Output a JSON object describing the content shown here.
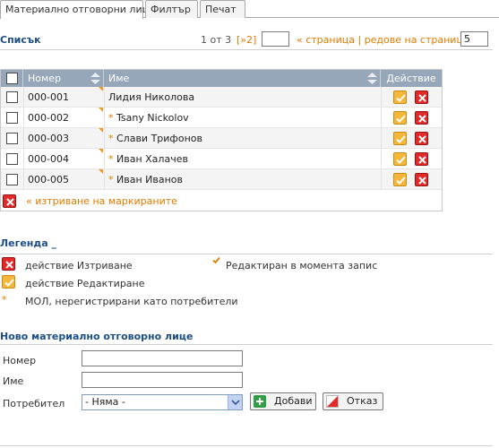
{
  "tabs": [
    {
      "label": "Материално отговорни лица",
      "active": true
    },
    {
      "label": "Филтър",
      "active": false
    },
    {
      "label": "Печат",
      "active": false
    }
  ],
  "list": {
    "title": "Списък",
    "pager": {
      "page_info": "1 от 3",
      "next_label": "[»2]",
      "goto_value": "",
      "page_rows_label": "« страница | редове на страница »",
      "rows_value": "5"
    },
    "columns": {
      "number": "Номер",
      "name": "Име",
      "action": "Действие"
    },
    "rows": [
      {
        "number": "000-001",
        "name": "Лидия Николова",
        "star": false
      },
      {
        "number": "000-002",
        "name": "Tsany Nickolov",
        "star": true
      },
      {
        "number": "000-003",
        "name": "Слави Трифонов",
        "star": true
      },
      {
        "number": "000-004",
        "name": "Иван Халачев",
        "star": true
      },
      {
        "number": "000-005",
        "name": "Иван Иванов",
        "star": true
      }
    ],
    "delete_selected_label": "« изтриване на маркираните"
  },
  "legend": {
    "title": "Легенда _",
    "delete_action": "действие Изтриване",
    "edited_now": "Редактиран в момента запис",
    "edit_action": "действие Редактиране",
    "star_desc": "МОЛ, нерегистрирани като потребители",
    "star_symbol": "*"
  },
  "new_form": {
    "title": "Ново материално отговорно лице",
    "number_label": "Номер",
    "number_value": "",
    "name_label": "Име",
    "name_value": "",
    "user_label": "Потребител",
    "user_selected": "- Няма -",
    "add_button": "Добави",
    "cancel_button": "Отказ"
  },
  "colors": {
    "accent": "#1c4e83",
    "header_bg": "#95a7b8",
    "orange": "#e07b00",
    "delete_red": "#e22a2a",
    "edit_orange": "#f4b73a"
  }
}
